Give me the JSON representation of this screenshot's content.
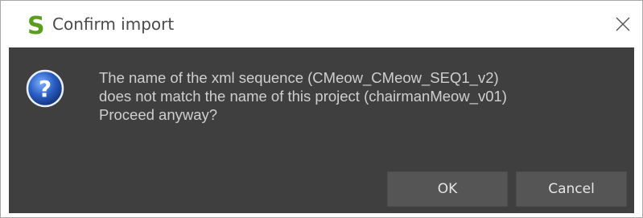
{
  "window": {
    "title": "Confirm import",
    "app_icon": "s-logo-icon",
    "close_icon": "close-icon"
  },
  "dialog": {
    "icon": "question-icon",
    "message_lines": [
      "The name of the xml sequence (CMeow_CMeow_SEQ1_v2)",
      "does not match the name of this project (chairmanMeow_v01)",
      "Proceed anyway?"
    ]
  },
  "buttons": {
    "ok_label": "OK",
    "cancel_label": "Cancel"
  },
  "colors": {
    "body_background": "#3f3f3f",
    "button_background": "#555555",
    "text": "#cfcfcf",
    "logo_green": "#5a9e1c",
    "question_blue": "#2a5fc4"
  }
}
